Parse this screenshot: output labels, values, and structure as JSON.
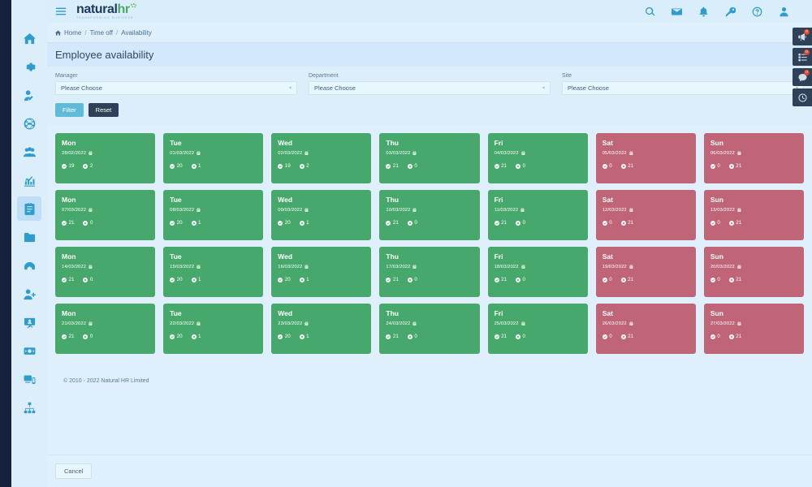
{
  "brand": {
    "logo_main": "natural",
    "logo_accent": "hr",
    "tagline": "TRANSFORMING BUSINESS",
    "accent_color": "#4aab62",
    "navy_color": "#1d3a5c"
  },
  "header": {
    "menu_icon": "hamburger-icon",
    "icons": [
      {
        "name": "search-icon",
        "label": "Search"
      },
      {
        "name": "envelope-icon",
        "label": "Messages"
      },
      {
        "name": "bell-icon",
        "label": "Notifications"
      },
      {
        "name": "key-icon",
        "label": "Permissions"
      },
      {
        "name": "help-icon",
        "label": "Help"
      },
      {
        "name": "user-icon",
        "label": "Account"
      }
    ]
  },
  "sidebar": {
    "items": [
      {
        "name": "home-icon",
        "label": "Home",
        "active": false
      },
      {
        "name": "gear-icon",
        "label": "Settings",
        "active": false
      },
      {
        "name": "user-edit-icon",
        "label": "My details",
        "active": false
      },
      {
        "name": "globe-icon",
        "label": "Company",
        "active": false
      },
      {
        "name": "users-icon",
        "label": "Employees",
        "active": false
      },
      {
        "name": "chart-icon",
        "label": "Reports",
        "active": false
      },
      {
        "name": "calendar-icon",
        "label": "Time off",
        "active": true
      },
      {
        "name": "folder-icon",
        "label": "Documents",
        "active": false
      },
      {
        "name": "gauge-icon",
        "label": "Performance",
        "active": false
      },
      {
        "name": "user-plus-icon",
        "label": "Recruitment",
        "active": false
      },
      {
        "name": "presentation-icon",
        "label": "Training",
        "active": false
      },
      {
        "name": "money-icon",
        "label": "Payroll",
        "active": false
      },
      {
        "name": "devices-icon",
        "label": "Assets",
        "active": false
      },
      {
        "name": "sitemap-icon",
        "label": "Org chart",
        "active": false
      }
    ]
  },
  "breadcrumb": {
    "home_icon": "home-icon",
    "items": [
      "Home",
      "Time off",
      "Availability"
    ],
    "separator": "/"
  },
  "page": {
    "title": "Employee availability"
  },
  "filters": {
    "fields": [
      {
        "label": "Manager",
        "value": "Please Choose",
        "name": "manager-select"
      },
      {
        "label": "Department",
        "value": "Please Choose",
        "name": "department-select"
      },
      {
        "label": "Site",
        "value": "Please Choose",
        "name": "site-select"
      }
    ],
    "filter_button": "Filter",
    "reset_button": "Reset",
    "filter_color": "#5fbcd8",
    "reset_color": "#2e4156",
    "caret_icon": "chevron-down-icon"
  },
  "legend": {
    "available_color": "#46a96b",
    "unavailable_color": "#bf6577",
    "available_icon": "check-circle-icon",
    "unavailable_icon": "times-circle-icon",
    "date_icon": "calendar-alt-icon"
  },
  "calendar": {
    "days": [
      {
        "day": "Mon",
        "date": "28/02/2022",
        "available": 19,
        "unavailable": 2,
        "status": "available"
      },
      {
        "day": "Tue",
        "date": "01/03/2022",
        "available": 20,
        "unavailable": 1,
        "status": "available"
      },
      {
        "day": "Wed",
        "date": "02/03/2022",
        "available": 19,
        "unavailable": 2,
        "status": "available"
      },
      {
        "day": "Thu",
        "date": "03/03/2022",
        "available": 21,
        "unavailable": 0,
        "status": "available"
      },
      {
        "day": "Fri",
        "date": "04/03/2022",
        "available": 21,
        "unavailable": 0,
        "status": "available"
      },
      {
        "day": "Sat",
        "date": "05/03/2022",
        "available": 0,
        "unavailable": 21,
        "status": "unavailable"
      },
      {
        "day": "Sun",
        "date": "06/03/2022",
        "available": 0,
        "unavailable": 21,
        "status": "unavailable"
      },
      {
        "day": "Mon",
        "date": "07/03/2022",
        "available": 21,
        "unavailable": 0,
        "status": "available"
      },
      {
        "day": "Tue",
        "date": "08/03/2022",
        "available": 20,
        "unavailable": 1,
        "status": "available"
      },
      {
        "day": "Wed",
        "date": "09/03/2022",
        "available": 20,
        "unavailable": 1,
        "status": "available"
      },
      {
        "day": "Thu",
        "date": "10/03/2022",
        "available": 21,
        "unavailable": 0,
        "status": "available"
      },
      {
        "day": "Fri",
        "date": "11/03/2022",
        "available": 21,
        "unavailable": 0,
        "status": "available"
      },
      {
        "day": "Sat",
        "date": "12/03/2022",
        "available": 0,
        "unavailable": 21,
        "status": "unavailable"
      },
      {
        "day": "Sun",
        "date": "13/03/2022",
        "available": 0,
        "unavailable": 21,
        "status": "unavailable"
      },
      {
        "day": "Mon",
        "date": "14/03/2022",
        "available": 21,
        "unavailable": 0,
        "status": "available"
      },
      {
        "day": "Tue",
        "date": "15/03/2022",
        "available": 20,
        "unavailable": 1,
        "status": "available"
      },
      {
        "day": "Wed",
        "date": "16/03/2022",
        "available": 20,
        "unavailable": 1,
        "status": "available"
      },
      {
        "day": "Thu",
        "date": "17/03/2022",
        "available": 21,
        "unavailable": 0,
        "status": "available"
      },
      {
        "day": "Fri",
        "date": "18/03/2022",
        "available": 21,
        "unavailable": 0,
        "status": "available"
      },
      {
        "day": "Sat",
        "date": "19/03/2022",
        "available": 0,
        "unavailable": 21,
        "status": "unavailable"
      },
      {
        "day": "Sun",
        "date": "20/03/2022",
        "available": 0,
        "unavailable": 21,
        "status": "unavailable"
      },
      {
        "day": "Mon",
        "date": "21/03/2022",
        "available": 21,
        "unavailable": 0,
        "status": "available"
      },
      {
        "day": "Tue",
        "date": "22/03/2022",
        "available": 20,
        "unavailable": 1,
        "status": "available"
      },
      {
        "day": "Wed",
        "date": "23/03/2022",
        "available": 20,
        "unavailable": 1,
        "status": "available"
      },
      {
        "day": "Thu",
        "date": "24/03/2022",
        "available": 21,
        "unavailable": 0,
        "status": "available"
      },
      {
        "day": "Fri",
        "date": "25/03/2022",
        "available": 21,
        "unavailable": 0,
        "status": "available"
      },
      {
        "day": "Sat",
        "date": "26/03/2022",
        "available": 0,
        "unavailable": 21,
        "status": "unavailable"
      },
      {
        "day": "Sun",
        "date": "27/03/2022",
        "available": 0,
        "unavailable": 21,
        "status": "unavailable"
      }
    ]
  },
  "footer": {
    "copyright": "© 2010 - 2022 Natural HR Limited"
  },
  "bottom_bar": {
    "cancel_button": "Cancel"
  },
  "rail": {
    "buttons": [
      {
        "name": "megaphone-icon",
        "badge": "0",
        "has_badge": true
      },
      {
        "name": "tasks-icon",
        "badge": "0",
        "has_badge": true
      },
      {
        "name": "chat-icon",
        "badge": "0",
        "has_badge": true
      },
      {
        "name": "clock-icon",
        "badge": "",
        "has_badge": false
      }
    ]
  }
}
